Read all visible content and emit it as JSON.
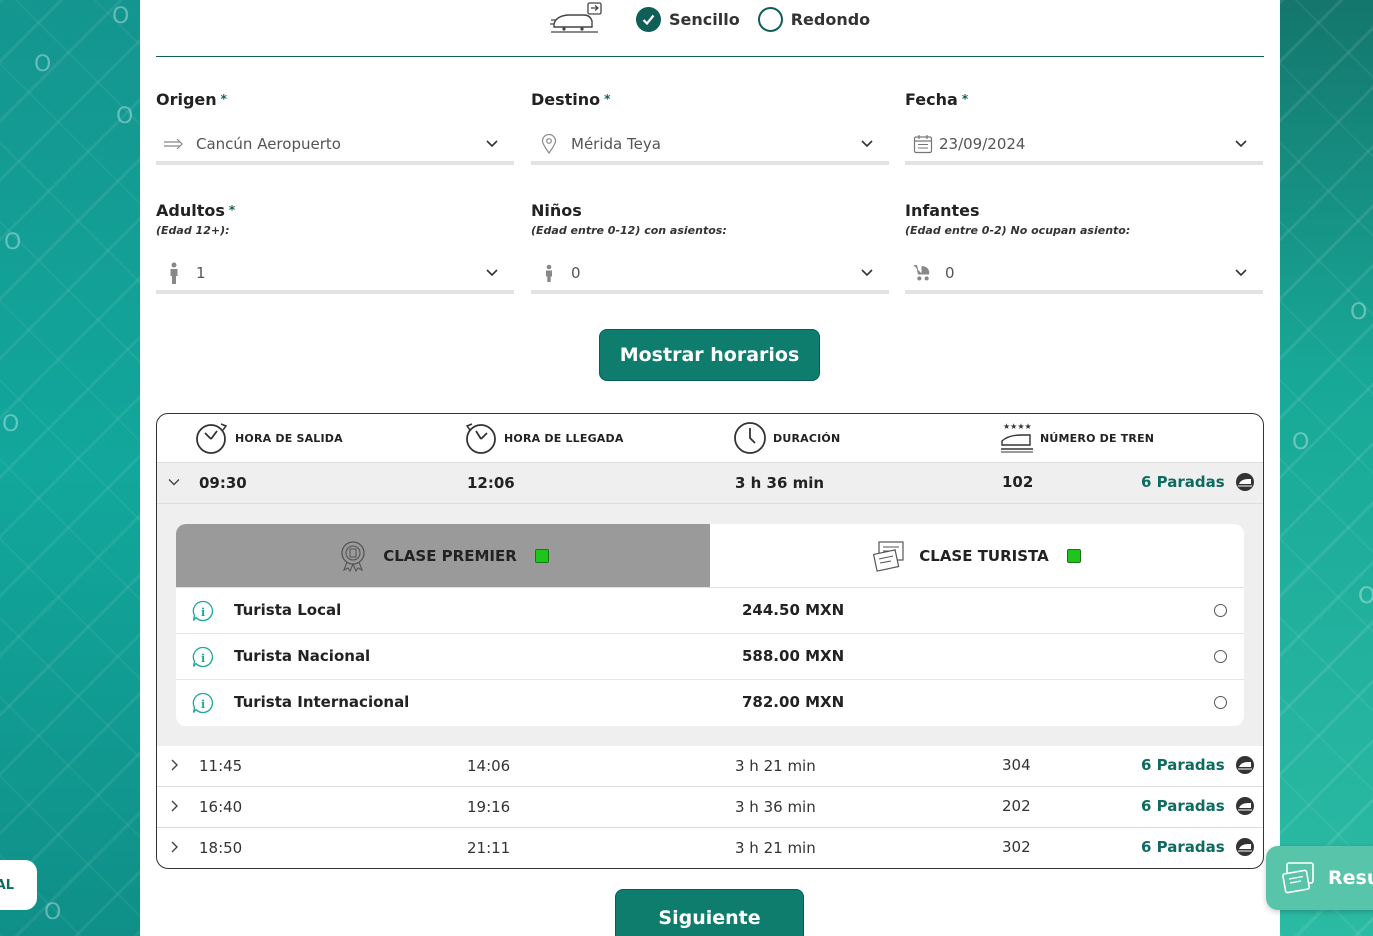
{
  "trip_type": {
    "options": [
      {
        "label": "Sencillo",
        "checked": true
      },
      {
        "label": "Redondo",
        "checked": false
      }
    ]
  },
  "form": {
    "origen": {
      "label": "Origen",
      "required_mark": "*",
      "value": "Cancún Aeropuerto",
      "icon": "arrow-right-icon"
    },
    "destino": {
      "label": "Destino",
      "required_mark": "*",
      "value": "Mérida Teya",
      "icon": "location-pin-icon"
    },
    "fecha": {
      "label": "Fecha",
      "required_mark": "*",
      "value": "23/09/2024",
      "icon": "calendar-icon"
    },
    "adultos": {
      "label": "Adultos",
      "required_mark": "*",
      "sub": "(Edad 12+):",
      "value": "1",
      "icon": "person-icon"
    },
    "ninos": {
      "label": "Niños",
      "sub": "(Edad entre 0-12) con asientos:",
      "value": "0",
      "icon": "child-icon"
    },
    "infantes": {
      "label": "Infantes",
      "sub": "(Edad entre 0-2) No ocupan asiento:",
      "value": "0",
      "icon": "stroller-icon"
    }
  },
  "show_button_label": "Mostrar horarios",
  "schedule": {
    "headers": {
      "salida": "HORA DE SALIDA",
      "llegada": "HORA DE LLEGADA",
      "duracion": "DURACIÓN",
      "tren": "NÚMERO DE TREN"
    },
    "trips": [
      {
        "salida": "09:30",
        "llegada": "12:06",
        "duracion": "3 h 36 min",
        "tren": "102",
        "paradas": "6 Paradas",
        "expanded": true
      },
      {
        "salida": "11:45",
        "llegada": "14:06",
        "duracion": "3 h 21 min",
        "tren": "304",
        "paradas": "6 Paradas",
        "expanded": false
      },
      {
        "salida": "16:40",
        "llegada": "19:16",
        "duracion": "3 h 36 min",
        "tren": "202",
        "paradas": "6 Paradas",
        "expanded": false
      },
      {
        "salida": "18:50",
        "llegada": "21:11",
        "duracion": "3 h 21 min",
        "tren": "302",
        "paradas": "6 Paradas",
        "expanded": false
      }
    ],
    "classes": {
      "premier": {
        "label": "CLASE PREMIER",
        "active": false
      },
      "turista": {
        "label": "CLASE TURISTA",
        "active": true
      }
    },
    "fares": [
      {
        "name": "Turista Local",
        "price": "244.50 MXN"
      },
      {
        "name": "Turista Nacional",
        "price": "588.00 MXN"
      },
      {
        "name": "Turista Internacional",
        "price": "782.00 MXN"
      }
    ]
  },
  "next_button_label": "Siguiente",
  "side_left_label": "AL",
  "side_right_label": "Resu",
  "colors": {
    "primary": "#0e7d6e",
    "dark_green": "#0f5f56",
    "status_green": "#1fc41f",
    "inactive_tab": "#9a9a9a",
    "row_highlight": "#efefef"
  }
}
